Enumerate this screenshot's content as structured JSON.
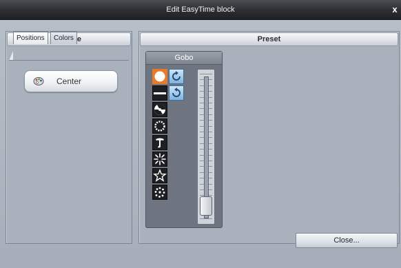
{
  "window": {
    "title": "Edit EasyTime block",
    "close_glyph": "x"
  },
  "palette": {
    "header": "Palette",
    "tabs": [
      {
        "label": "Positions",
        "active": true
      },
      {
        "label": "Colors",
        "active": false
      }
    ],
    "items": [
      {
        "label": "Center",
        "icon": "palette-icon"
      }
    ]
  },
  "preset": {
    "header": "Preset",
    "gobo": {
      "title": "Gobo",
      "gobos": [
        {
          "icon": "open-gobo-icon",
          "selected": true
        },
        {
          "icon": "bar-gobo-icon",
          "selected": false
        },
        {
          "icon": "three-blade-gobo-icon",
          "selected": false
        },
        {
          "icon": "dotted-ring-gobo-icon",
          "selected": false
        },
        {
          "icon": "swirl-gobo-icon",
          "selected": false
        },
        {
          "icon": "burst-gobo-icon",
          "selected": false
        },
        {
          "icon": "star-gobo-icon",
          "selected": false
        },
        {
          "icon": "dots-gobo-icon",
          "selected": false
        }
      ],
      "rotation_buttons": [
        {
          "icon": "rotate-cw-icon",
          "selected": true
        },
        {
          "icon": "rotate-ccw-icon",
          "selected": false
        }
      ],
      "slider_value": 0.05
    }
  },
  "footer": {
    "close_label": "Close..."
  },
  "colors": {
    "accent_selected": "#e87a2a",
    "titlebar": "#2c2e31",
    "background": "#a7b0bb"
  }
}
